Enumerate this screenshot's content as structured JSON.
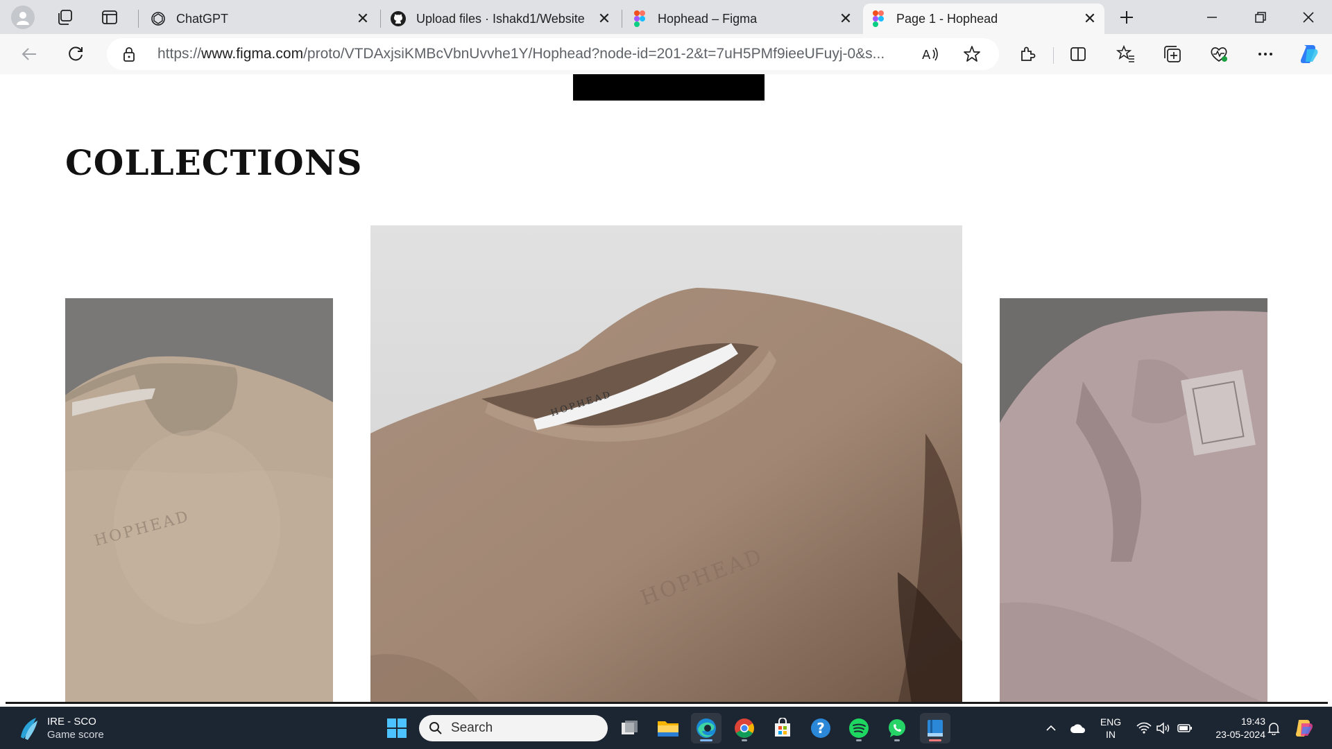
{
  "browser": {
    "tabs": [
      {
        "title": "ChatGPT",
        "icon": "chatgpt-icon",
        "active": false
      },
      {
        "title": "Upload files · Ishakd1/Website",
        "icon": "github-icon",
        "active": false
      },
      {
        "title": "Hophead – Figma",
        "icon": "figma-icon",
        "active": false
      },
      {
        "title": "Page 1 - Hophead",
        "icon": "figma-icon",
        "active": true
      }
    ],
    "url_prefix": "https://",
    "url_host": "www.figma.com",
    "url_rest": "/proto/VTDAxjsiKMBcVbnUvvhe1Y/Hophead?node-id=201-2&t=7uH5PMf9ieeUFuyj-0&s..."
  },
  "page": {
    "section_title": "COLLECTIONS",
    "products": [
      {
        "name": "beige-crewneck-tee",
        "stamp": "HOPHEAD",
        "color": "#b9a592"
      },
      {
        "name": "taupe-crewneck-tee",
        "stamp": "HOPHEAD",
        "color": "#a48a78"
      },
      {
        "name": "pink-polo-shirt",
        "stamp": "",
        "color": "#b8a2a2"
      }
    ],
    "label_text": "HOPHEAD"
  },
  "taskbar": {
    "widget_title": "IRE - SCO",
    "widget_subtitle": "Game score",
    "search_placeholder": "Search",
    "lang_top": "ENG",
    "lang_bottom": "IN",
    "time": "19:43",
    "date": "23-05-2024"
  }
}
